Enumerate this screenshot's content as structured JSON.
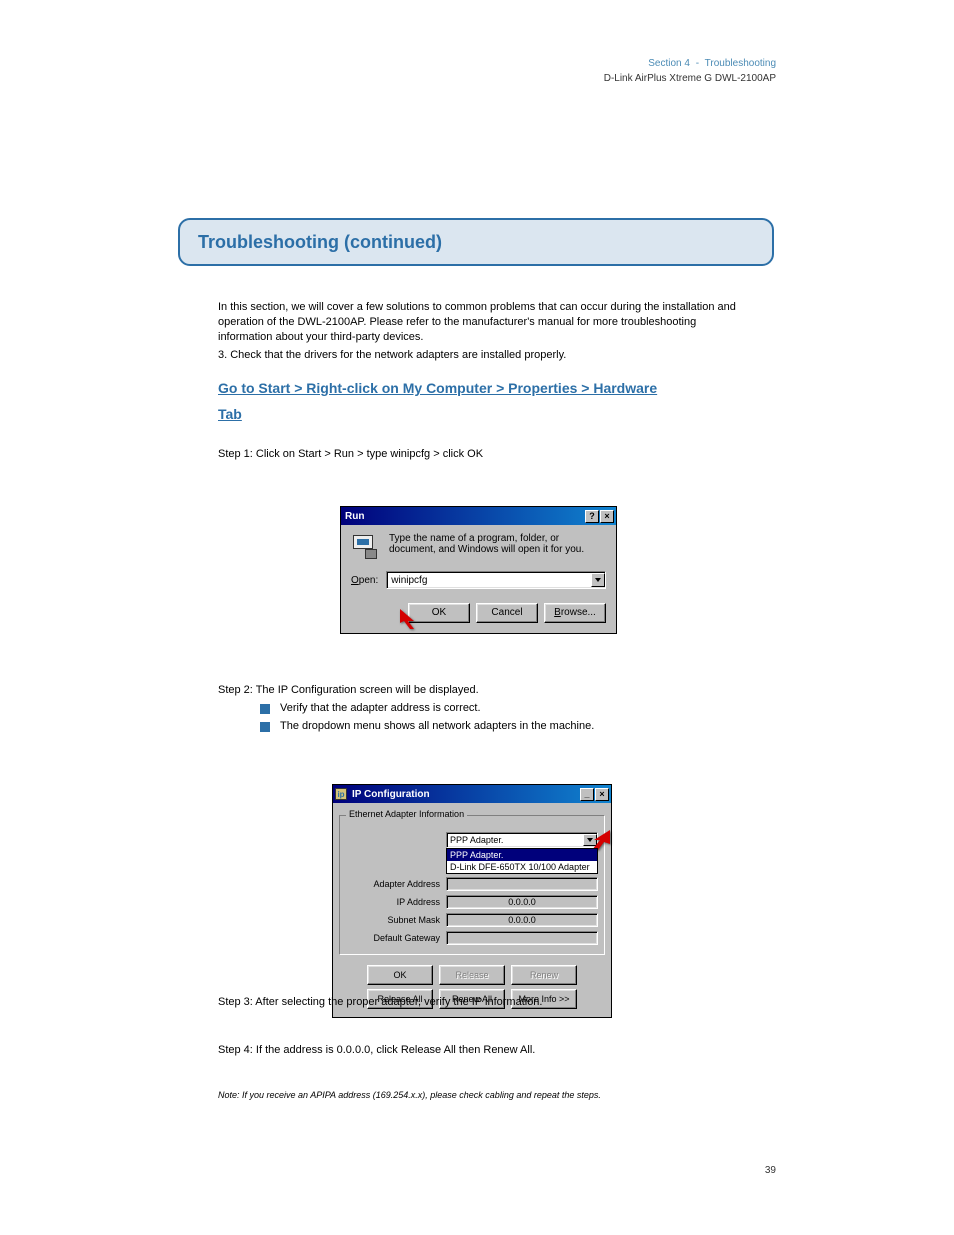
{
  "header": {
    "breadcrumb_section": "Section 4",
    "breadcrumb_page": "Troubleshooting",
    "product_name": "D-Link AirPlus Xtreme G DWL-2100AP"
  },
  "section_heading": "Troubleshooting (continued)",
  "intro_para_1": "In this section, we will cover a few solutions to common problems that can occur during the installation and operation of the DWL-2100AP. Please refer to the manufacturer's manual for more troubleshooting information about your third-party devices.",
  "intro_para_2": "3. Check that the drivers for the network adapters are installed properly.",
  "link_heading_1": "Go to Start > Right-click on My Computer > Properties > Hardware",
  "link_heading_2": "Tab",
  "steps": {
    "s1": "Step 1: Click on Start > Run > type winipcfg > click OK",
    "s2_intro": "Step 2: The IP Configuration screen will be displayed.",
    "s2_b1": "Verify that the adapter address is correct.",
    "s2_b2": "The dropdown menu shows all network adapters in the machine.",
    "s3": "Step 3: After selecting the proper adapter, verify the IP information.",
    "s4": "Step 4: If the address is 0.0.0.0, click Release All then Renew All."
  },
  "footnote": "Note: If you receive an APIPA address (169.254.x.x), please check cabling and repeat the steps.",
  "run_dialog": {
    "title": "Run",
    "help_btn": "?",
    "close_btn": "×",
    "description": "Type the name of a program, folder, or document, and Windows will open it for you.",
    "open_label_pre": "O",
    "open_label_post": "pen:",
    "open_value": "winipcfg",
    "ok": "OK",
    "cancel": "Cancel",
    "browse_pre": "B",
    "browse_post": "rowse..."
  },
  "ipcfg_dialog": {
    "title": "IP Configuration",
    "min_btn": "_",
    "close_btn": "×",
    "group_title": "Ethernet Adapter Information",
    "adapter_selected": "PPP Adapter.",
    "dd_item_sel": "PPP Adapter.",
    "dd_item_2": "D-Link DFE-650TX 10/100 Adapter",
    "lbl_adapter_addr": "Adapter Address",
    "lbl_ip": "IP Address",
    "val_ip": "0.0.0.0",
    "lbl_subnet": "Subnet Mask",
    "val_subnet": "0.0.0.0",
    "lbl_gateway": "Default Gateway",
    "val_gateway": "",
    "btn_ok": "OK",
    "btn_release": "Release",
    "btn_renew": "Renew",
    "btn_release_all": "Release All",
    "btn_renew_all": "Renew All",
    "btn_more": "More Info >>"
  },
  "page_number": "39"
}
